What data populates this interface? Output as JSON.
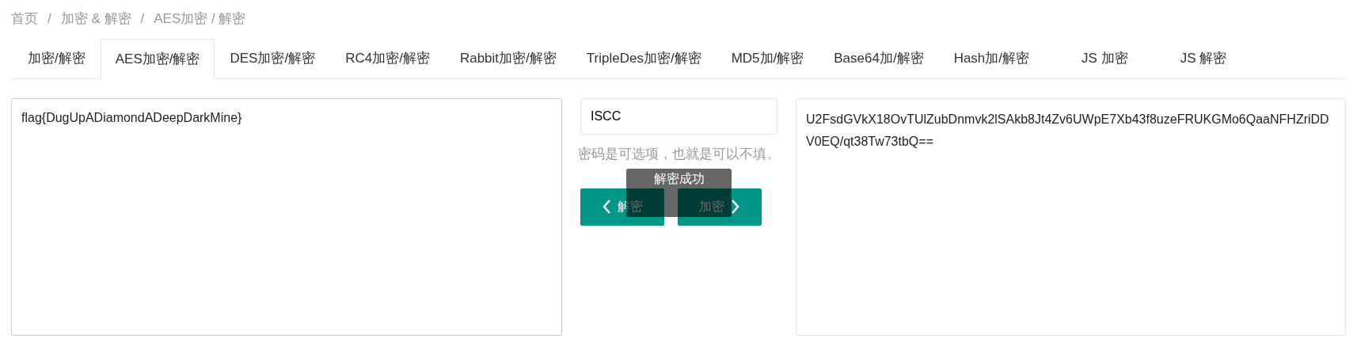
{
  "breadcrumb": [
    {
      "kind": "link",
      "text": "首页"
    },
    {
      "kind": "separator",
      "text": "/"
    },
    {
      "kind": "link",
      "text": "加密 & 解密"
    },
    {
      "kind": "separator",
      "text": "/"
    },
    {
      "kind": "link",
      "text": "AES加密 / 解密"
    }
  ],
  "tabs": [
    {
      "label": "加密/解密",
      "selected": false
    },
    {
      "label": "AES加密/解密",
      "selected": true
    },
    {
      "label": "DES加密/解密",
      "selected": false
    },
    {
      "label": "RC4加密/解密",
      "selected": false
    },
    {
      "label": "Rabbit加密/解密",
      "selected": false
    },
    {
      "label": "TripleDes加密/解密",
      "selected": false
    },
    {
      "label": "MD5加/解密",
      "selected": false
    },
    {
      "label": "Base64加/解密",
      "selected": false
    },
    {
      "label": "Hash加/解密",
      "selected": false
    },
    {
      "label": "JS 加密",
      "selected": false
    },
    {
      "label": "JS 解密",
      "selected": false
    }
  ],
  "plaintext": {
    "value": "flag{DugUpADiamondADeepDarkMine}"
  },
  "key": {
    "value": "ISCC"
  },
  "key_hint": "密码是可选项，也就是可以不填。",
  "buttons": [
    {
      "label": "解密",
      "kind": "decrypt"
    },
    {
      "label": "加密",
      "kind": "encrypt"
    }
  ],
  "toast": "解密成功",
  "ciphertext": {
    "value": "U2FsdGVkX18OvTUlZubDnmvk2lSAkb8Jt4Zv6UWpE7Xb43f8uzeFRUKGMo6QaaNFHZriDDV0EQ/qt38Tw73tbQ=="
  }
}
